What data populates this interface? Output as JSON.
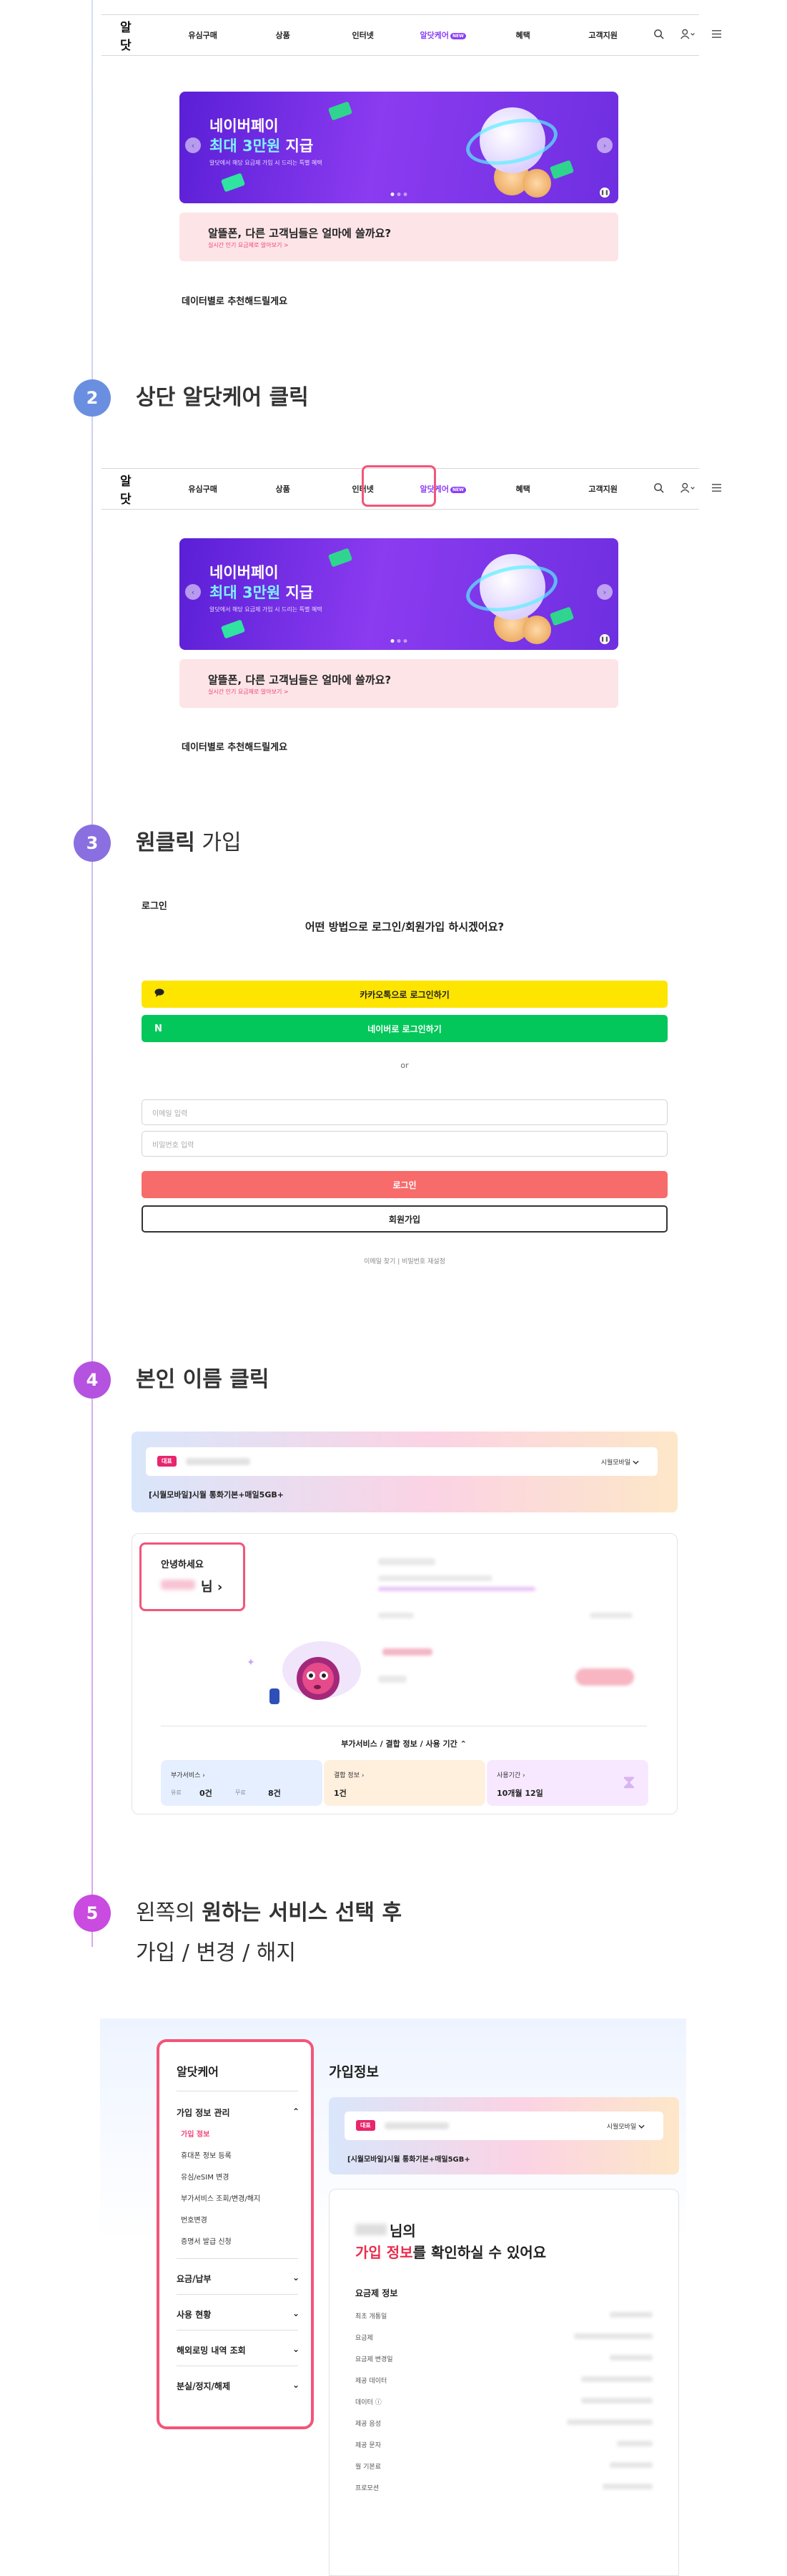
{
  "header": {
    "logo": "알닷",
    "nav": [
      "유심구매",
      "상품",
      "인터넷",
      "알닷케어",
      "혜택",
      "고객지원"
    ],
    "new_badge": "NEW",
    "icons": [
      "search-icon",
      "user-icon",
      "chevron-down-icon",
      "menu-icon"
    ]
  },
  "banner": {
    "line1": "네이버페이",
    "line2_highlight": "최대 3만원",
    "line2_rest": " 지급",
    "line3": "알닷에서 해당 요금제 가입 시 드리는 특별 혜택",
    "prev_arrow": "‹",
    "next_arrow": "›",
    "pause": "❚❚"
  },
  "pinkbox": {
    "question": "알뜰폰, 다른 고객님들은 얼마에 쓸까요?",
    "sub": "실시간 인기 요금제로 알아보기 >"
  },
  "recommend": "데이터별로 추천해드릴게요",
  "steps": [
    {
      "num": "2",
      "bold": "상단 알닷케어 클릭",
      "light": ""
    },
    {
      "num": "3",
      "bold": "원클릭",
      "light": " 가입"
    },
    {
      "num": "4",
      "bold": "본인 이름 클릭",
      "light": ""
    },
    {
      "num": "5",
      "line1_light": "왼쪽의 ",
      "line1_bold": "원하는 서비스 선택 후",
      "line2": "가입 / 변경 / 해지"
    }
  ],
  "colors": {
    "step2": "#6b8fe0",
    "step3": "#8a6fe0",
    "step4": "#b553e0",
    "step5": "#c94be0",
    "highlight": "#f25579"
  },
  "login": {
    "label": "로그인",
    "question": "어떤 방법으로 로그인/회원가입 하시겠어요?",
    "kakao": "카카오톡으로 로그인하기",
    "naver": "네이버로 로그인하기",
    "naver_mark": "N",
    "or": "or",
    "email_placeholder": "이메일 입력",
    "password_placeholder": "비밀번호 입력",
    "login_button": "로그인",
    "join_button": "회원가입",
    "links": "이메일 찾기 | 비밀번호 재설정"
  },
  "step4": {
    "badge": "대표",
    "carrier": "시월모바일",
    "plan_name": "[시월모바일]시월 통화기본+매일5GB+",
    "hello": "안녕하세요",
    "nim": "님 ›",
    "extras_label": "부가서비스 / 결합 정보 / 사용 기간 ⌃",
    "tiles": [
      {
        "title": "부가서비스 ›",
        "paid_label": "유료",
        "paid_value": "0건",
        "free_label": "무료",
        "free_value": "8건"
      },
      {
        "title": "결합 정보 ›",
        "value": "1건"
      },
      {
        "title": "사용기간 ›",
        "value": "10개월 12일"
      }
    ]
  },
  "step5": {
    "sidebar_title": "알닷케어",
    "menu": [
      {
        "label": "가입 정보 관리",
        "chevron": "⌃",
        "subs": [
          "가입 정보",
          "휴대폰 정보 등록",
          "유심/eSIM 변경",
          "부가서비스 조회/변경/해지",
          "번호변경",
          "증명서 발급 신청"
        ]
      },
      {
        "label": "요금/납부",
        "chevron": "⌄"
      },
      {
        "label": "사용 현황",
        "chevron": "⌄"
      },
      {
        "label": "해외로밍 내역 조회",
        "chevron": "⌄"
      },
      {
        "label": "분실/정지/해제",
        "chevron": "⌄"
      }
    ],
    "right_title": "가입정보",
    "badge": "대표",
    "carrier": "시월모바일",
    "plan_name": "[시월모바일]시월 통화기본+매일5GB+",
    "nim": "님의",
    "line2_red": "가입 정보",
    "line2_rest": "를 확인하실 수 있어요",
    "section": "요금제 정보",
    "rows": [
      "최초 개통일",
      "요금제",
      "요금제 변경일",
      "제공 데이터",
      "데이터 ⓘ",
      "제공 음성",
      "제공 문자",
      "월 기본료",
      "프로모션"
    ]
  }
}
